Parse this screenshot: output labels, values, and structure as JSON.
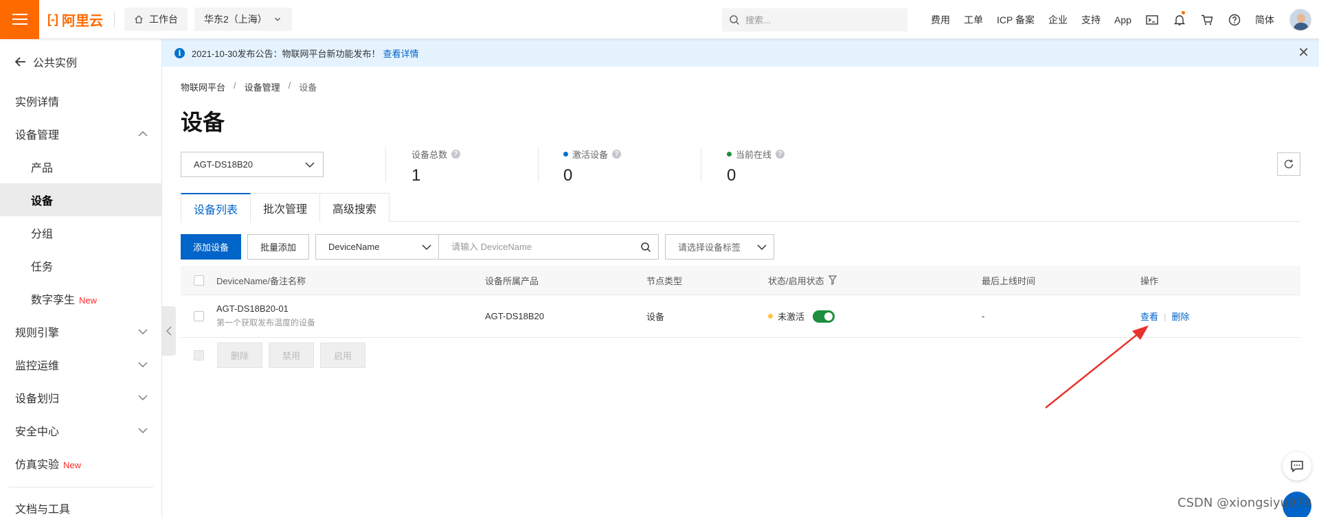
{
  "header": {
    "logo_text": "阿里云",
    "workbench_label": "工作台",
    "region_label": "华东2（上海）",
    "search_placeholder": "搜索...",
    "nav_links": [
      "费用",
      "工单",
      "ICP 备案",
      "企业",
      "支持",
      "App"
    ],
    "language_label": "简体"
  },
  "sidebar": {
    "back_label": "公共实例",
    "items": [
      {
        "label": "实例详情"
      },
      {
        "label": "设备管理"
      },
      {
        "label": "产品"
      },
      {
        "label": "设备"
      },
      {
        "label": "分组"
      },
      {
        "label": "任务"
      },
      {
        "label": "数字孪生",
        "badge": "New"
      },
      {
        "label": "规则引擎"
      },
      {
        "label": "监控运维"
      },
      {
        "label": "设备划归"
      },
      {
        "label": "安全中心"
      },
      {
        "label": "仿真实验",
        "badge": "New"
      },
      {
        "label": "文档与工具"
      }
    ]
  },
  "notice": {
    "text": "2021-10-30发布公告：物联网平台新功能发布！",
    "link": "查看详情"
  },
  "breadcrumb": [
    "物联网平台",
    "设备管理",
    "设备"
  ],
  "page_title": "设备",
  "product_select": "AGT-DS18B20",
  "stats": [
    {
      "label": "设备总数",
      "value": "1"
    },
    {
      "label": "激活设备",
      "value": "0",
      "dot_color": "#0070cc"
    },
    {
      "label": "当前在线",
      "value": "0",
      "dot_color": "#1e8e3e"
    }
  ],
  "tabs": [
    "设备列表",
    "批次管理",
    "高级搜索"
  ],
  "toolbar": {
    "add_device": "添加设备",
    "batch_add": "批量添加",
    "field_select": "DeviceName",
    "search_placeholder": "请输入 DeviceName",
    "tag_select_placeholder": "请选择设备标签"
  },
  "table": {
    "columns": [
      "DeviceName/备注名称",
      "设备所属产品",
      "节点类型",
      "状态/启用状态",
      "最后上线时间",
      "操作"
    ],
    "rows": [
      {
        "device_name": "AGT-DS18B20-01",
        "remark": "第一个获取发布温度的设备",
        "product": "AGT-DS18B20",
        "node_type": "设备",
        "status": "未激活",
        "enabled": true,
        "last_online": "-",
        "actions": [
          "查看",
          "删除"
        ]
      }
    ]
  },
  "bulk_actions": [
    "删除",
    "禁用",
    "启用"
  ],
  "watermark": "CSDN @xiongsiyu979",
  "colors": {
    "brand_orange": "#ff6a00",
    "primary_blue": "#0064c8",
    "toggle_green": "#1e8e3e",
    "status_yellow": "#ffc440",
    "new_badge_red": "#ff2b2b",
    "annotation_arrow": "#e8322d"
  }
}
